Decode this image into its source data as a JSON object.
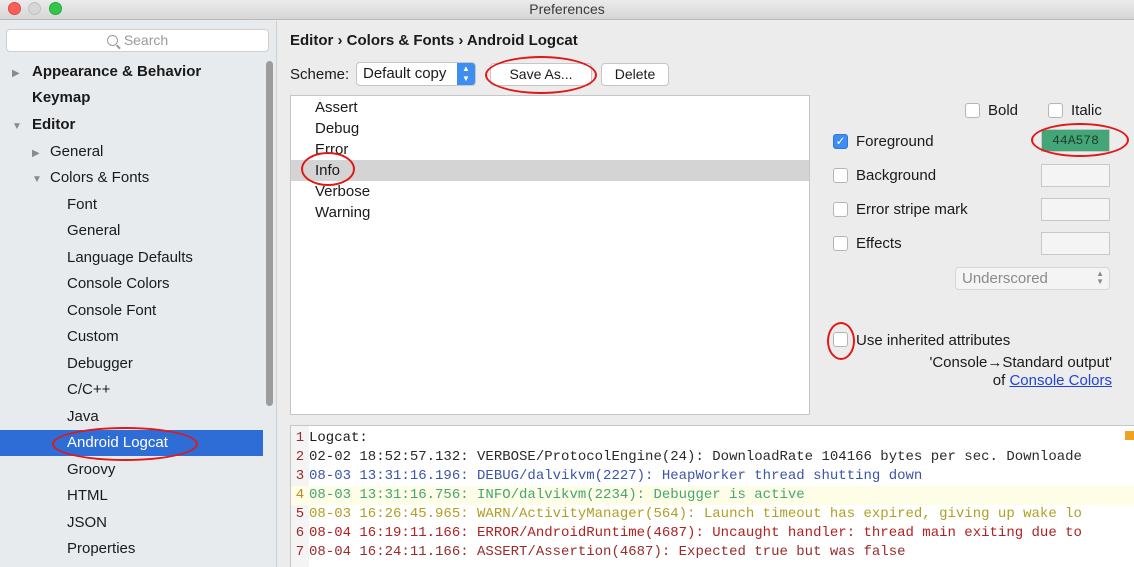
{
  "window": {
    "title": "Preferences"
  },
  "search": {
    "placeholder": "Search"
  },
  "sidebar": {
    "items": [
      {
        "label": "Appearance & Behavior"
      },
      {
        "label": "Keymap"
      },
      {
        "label": "Editor"
      },
      {
        "label": "General"
      },
      {
        "label": "Colors & Fonts"
      },
      {
        "label": "Font"
      },
      {
        "label": "General"
      },
      {
        "label": "Language Defaults"
      },
      {
        "label": "Console Colors"
      },
      {
        "label": "Console Font"
      },
      {
        "label": "Custom"
      },
      {
        "label": "Debugger"
      },
      {
        "label": "C/C++"
      },
      {
        "label": "Java"
      },
      {
        "label": "Android Logcat"
      },
      {
        "label": "Groovy"
      },
      {
        "label": "HTML"
      },
      {
        "label": "JSON"
      },
      {
        "label": "Properties"
      }
    ]
  },
  "breadcrumb": "Editor › Colors & Fonts › Android Logcat",
  "scheme": {
    "label": "Scheme:",
    "value": "Default copy",
    "save_as": "Save As...",
    "delete": "Delete"
  },
  "list": {
    "items": [
      "Assert",
      "Debug",
      "Error",
      "Info",
      "Verbose",
      "Warning"
    ],
    "selected": "Info"
  },
  "attributes": {
    "bold": "Bold",
    "italic": "Italic",
    "foreground": "Foreground",
    "foreground_color": "44A578",
    "background": "Background",
    "error_stripe": "Error stripe mark",
    "effects": "Effects",
    "effect_type": "Underscored",
    "inherited": "Use inherited attributes",
    "inherited_from": "'Console→Standard output'",
    "of": "of",
    "console_colors_link": "Console Colors"
  },
  "colors": {
    "accent": "#2e6dd6",
    "foreground_swatch": "#44a578",
    "highlight_ring": "#e01818"
  },
  "preview": {
    "lines": [
      {
        "num": "1",
        "text": "Logcat:",
        "color": "#1a1a1a"
      },
      {
        "num": "2",
        "text": "02-02 18:52:57.132: VERBOSE/ProtocolEngine(24): DownloadRate 104166 bytes per sec. Downloade",
        "color": "#2a2a2a"
      },
      {
        "num": "3",
        "text": "08-03 13:31:16.196: DEBUG/dalvikvm(2227): HeapWorker thread shutting down",
        "color": "#3b55a8"
      },
      {
        "num": "4",
        "text": "08-03 13:31:16.756: INFO/dalvikvm(2234): Debugger is active",
        "color": "#44a578"
      },
      {
        "num": "5",
        "text": "08-03 16:26:45.965: WARN/ActivityManager(564): Launch timeout has expired, giving up wake lo",
        "color": "#b0a020"
      },
      {
        "num": "6",
        "text": "08-04 16:19:11.166: ERROR/AndroidRuntime(4687): Uncaught handler: thread main exiting due to",
        "color": "#b22020"
      },
      {
        "num": "7",
        "text": "08-04 16:24:11.166: ASSERT/Assertion(4687): Expected true but was false",
        "color": "#9a2b2b"
      }
    ]
  }
}
